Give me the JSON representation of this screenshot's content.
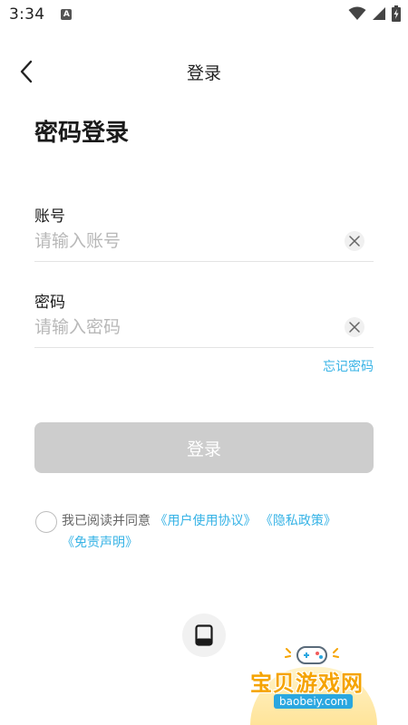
{
  "status_bar": {
    "time": "3:34",
    "notification_icon": "A"
  },
  "header": {
    "title": "登录",
    "back_icon": "chevron-left-icon"
  },
  "page_title": "密码登录",
  "account": {
    "label": "账号",
    "placeholder": "请输入账号",
    "value": ""
  },
  "password": {
    "label": "密码",
    "placeholder": "请输入密码",
    "value": ""
  },
  "forgot_password": "忘记密码",
  "login_button": "登录",
  "agreement": {
    "prefix": "我已阅读并同意",
    "user_agreement": "《用户使用协议》",
    "privacy_policy": "《隐私政策》",
    "disclaimer": "《免责声明》",
    "checked": false
  },
  "device_login_icon": "tablet-icon",
  "watermark": {
    "title": "宝贝游戏网",
    "url": "baobeiy.com"
  },
  "colors": {
    "link": "#37b3e6",
    "button_disabled": "#cdcdcd",
    "watermark": "#f5a300"
  }
}
